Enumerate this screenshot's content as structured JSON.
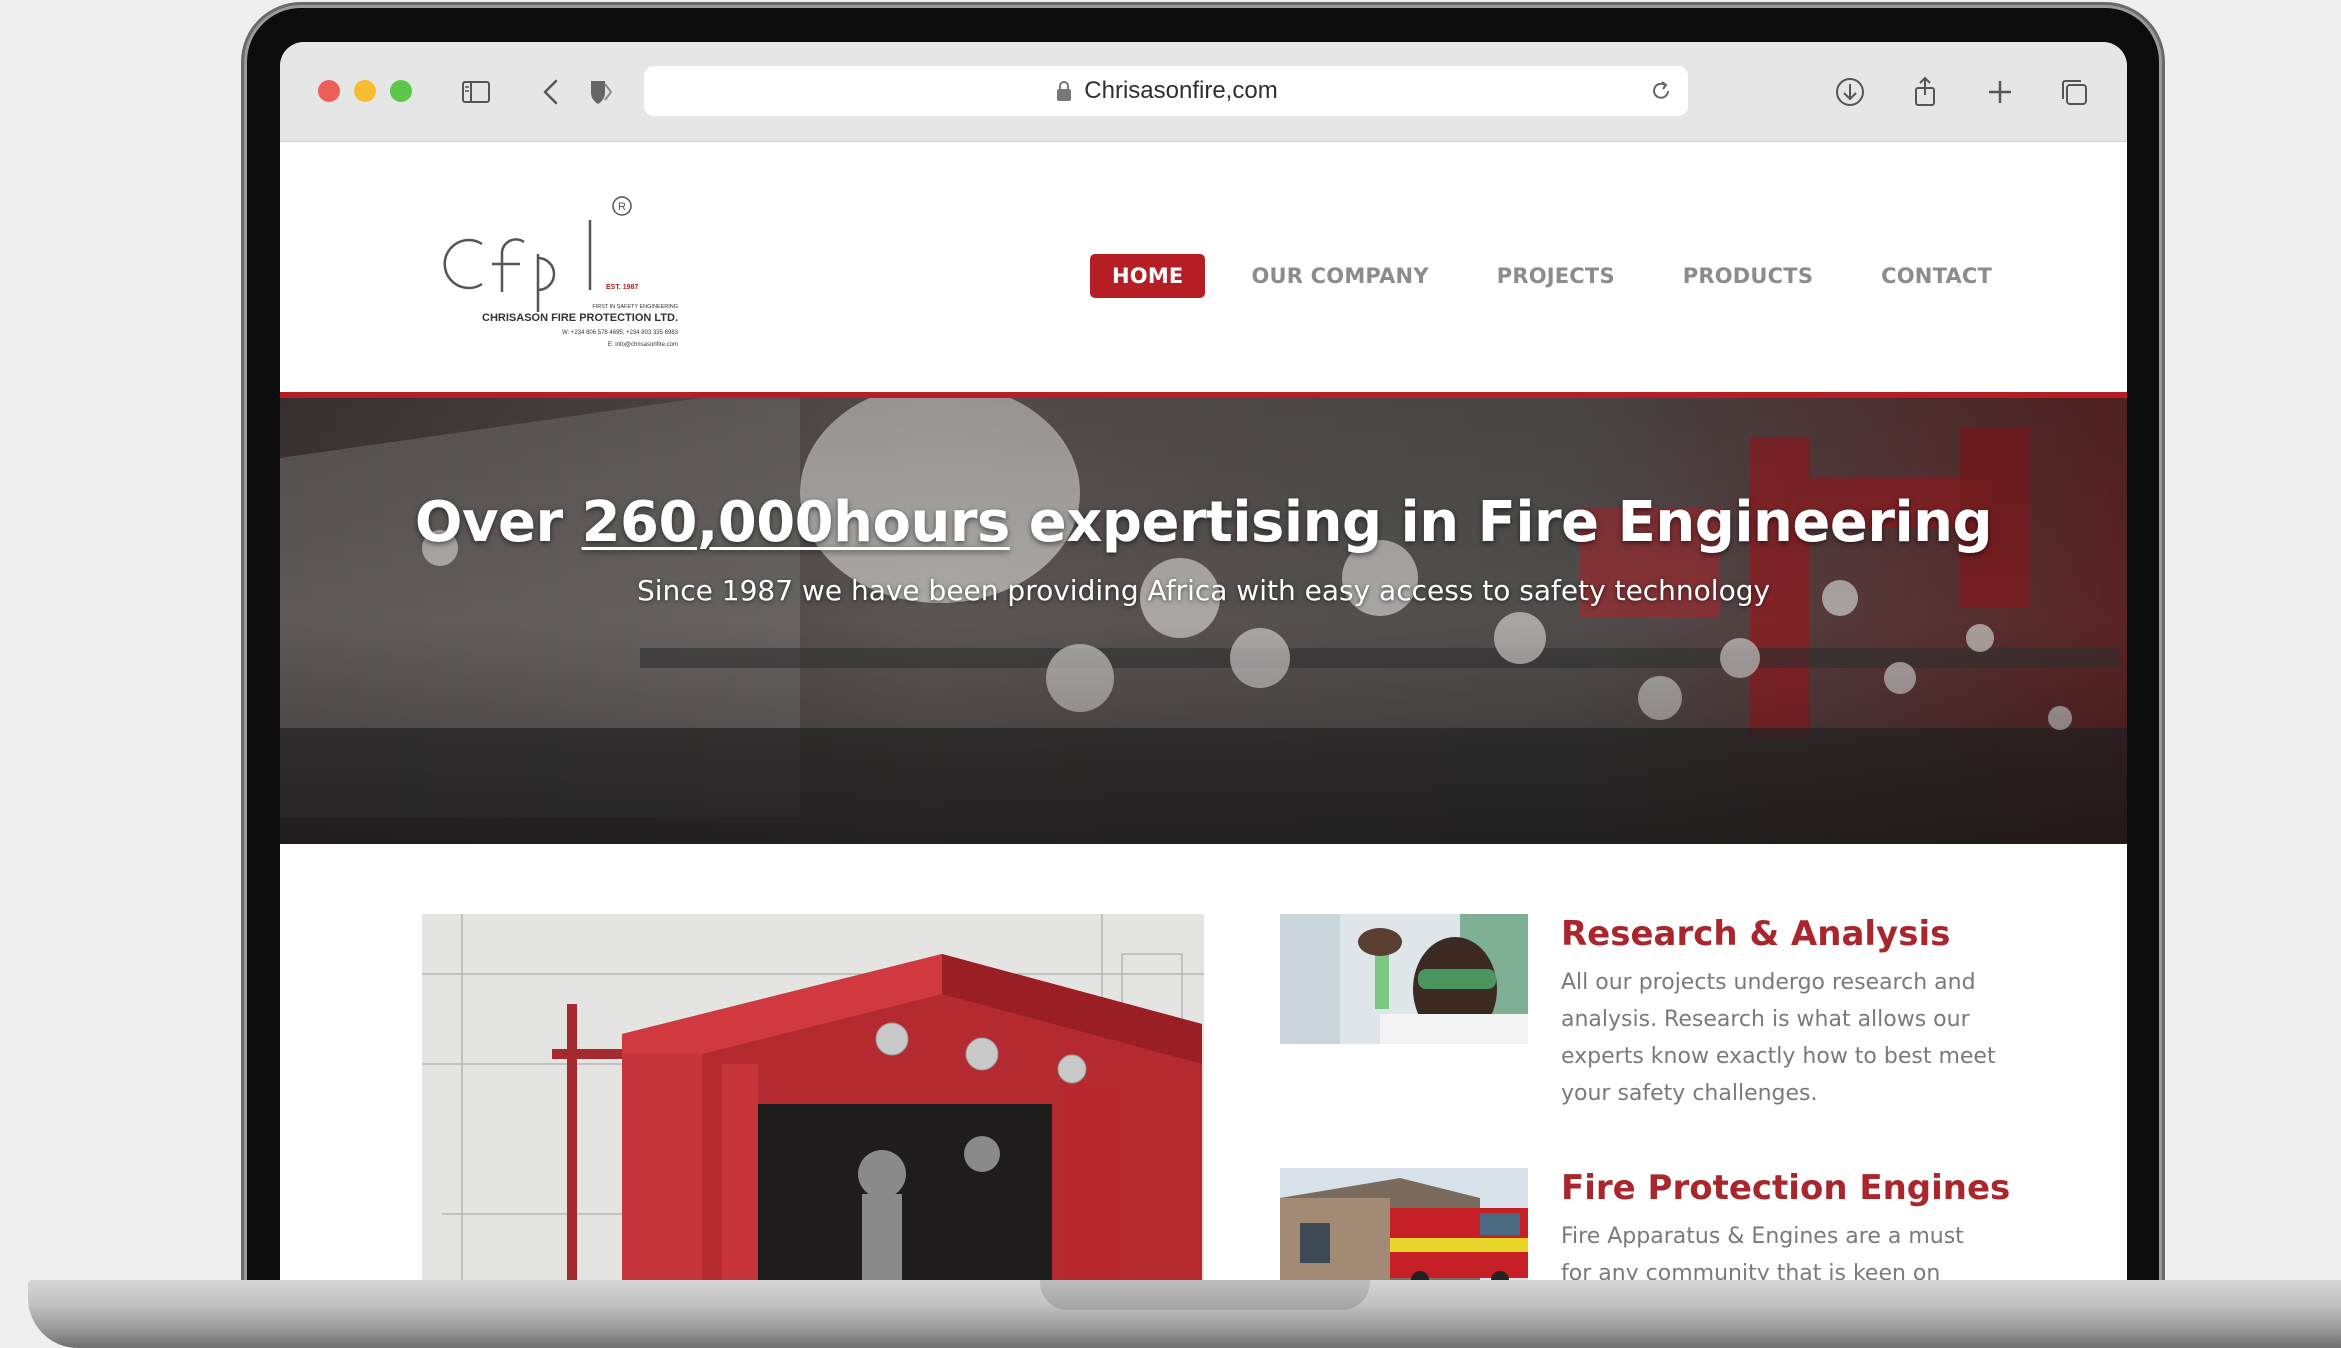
{
  "browser": {
    "url": "Chrisasonfire,com"
  },
  "logo": {
    "mark": "cfpl",
    "registered": "®",
    "est": "EST. 1987",
    "tagline": "FIRST IN SAFETY ENGINEERING",
    "company": "CHRISASON FIRE PROTECTION LTD.",
    "phone": "W: +234 806 578 4695; +234 803 335 6983",
    "email": "E: info@chrisasonfire.com"
  },
  "nav": {
    "items": [
      {
        "label": "HOME",
        "active": true
      },
      {
        "label": "OUR COMPANY",
        "active": false
      },
      {
        "label": "PROJECTS",
        "active": false
      },
      {
        "label": "PRODUCTS",
        "active": false
      },
      {
        "label": "CONTACT",
        "active": false
      }
    ]
  },
  "hero": {
    "title_prefix": "Over ",
    "title_highlight": "260,000hours",
    "title_suffix": " expertising in Fire Engineering",
    "subtitle": "Since 1987 we have been providing Africa with easy access to safety technology"
  },
  "cards": [
    {
      "title": "Research & Analysis",
      "text": "All our projects undergo research and analysis. Research is what allows our experts know exactly how to best meet your safety challenges."
    },
    {
      "title": "Fire Protection Engines",
      "text": "Fire Apparatus & Engines are a must for any community that is keen on"
    }
  ],
  "colors": {
    "brand_red": "#b41e24",
    "card_title": "#a9272c",
    "nav_gray": "#8c8c8c"
  }
}
